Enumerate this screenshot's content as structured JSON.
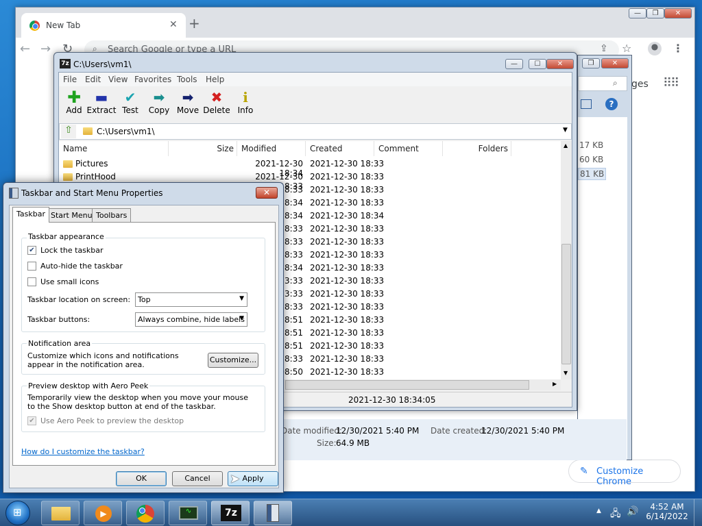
{
  "chrome": {
    "tab_title": "New Tab",
    "omnibox_placeholder": "Search Google or type a URL",
    "partial_label_images": "ges",
    "customize_chrome": "Customize Chrome",
    "file_sizes": [
      "17 KB",
      "60 KB",
      "81 KB"
    ]
  },
  "sevenzip": {
    "title": "C:\\Users\\vm1\\",
    "path": "C:\\Users\\vm1\\",
    "menu": [
      "File",
      "Edit",
      "View",
      "Favorites",
      "Tools",
      "Help"
    ],
    "toolbar": [
      {
        "label": "Add",
        "glyph": "+",
        "color": "#1fa31f"
      },
      {
        "label": "Extract",
        "glyph": "━",
        "color": "#2233aa"
      },
      {
        "label": "Test",
        "glyph": "✔",
        "color": "#1ba4b0"
      },
      {
        "label": "Copy",
        "glyph": "➡",
        "color": "#1a8f8f"
      },
      {
        "label": "Move",
        "glyph": "➡",
        "color": "#14216e"
      },
      {
        "label": "Delete",
        "glyph": "✖",
        "color": "#d42020"
      },
      {
        "label": "Info",
        "glyph": "i",
        "color": "#b8a400"
      }
    ],
    "columns": [
      "Name",
      "Size",
      "Modified",
      "Created",
      "Comment",
      "Folders"
    ],
    "rows": [
      {
        "name": "Pictures",
        "modified": "2021-12-30 18:34",
        "created": "2021-12-30 18:33"
      },
      {
        "name": "PrintHood",
        "modified": "2021-12-30 18:33",
        "created": "2021-12-30 18:33"
      },
      {
        "name": "",
        "modified": "18:33",
        "created": "2021-12-30 18:33"
      },
      {
        "name": "",
        "modified": "18:34",
        "created": "2021-12-30 18:33"
      },
      {
        "name": "",
        "modified": "18:34",
        "created": "2021-12-30 18:34"
      },
      {
        "name": "",
        "modified": "18:33",
        "created": "2021-12-30 18:33"
      },
      {
        "name": "",
        "modified": "18:33",
        "created": "2021-12-30 18:33"
      },
      {
        "name": "",
        "modified": "18:33",
        "created": "2021-12-30 18:33"
      },
      {
        "name": "",
        "modified": "18:34",
        "created": "2021-12-30 18:33"
      },
      {
        "name": "",
        "modified": "13:33",
        "created": "2021-12-30 18:33"
      },
      {
        "name": "",
        "modified": "13:33",
        "created": "2021-12-30 18:33"
      },
      {
        "name": "",
        "modified": "18:33",
        "created": "2021-12-30 18:33"
      },
      {
        "name": "",
        "modified": "18:51",
        "created": "2021-12-30 18:33"
      },
      {
        "name": "",
        "modified": "18:51",
        "created": "2021-12-30 18:33"
      },
      {
        "name": "",
        "modified": "18:51",
        "created": "2021-12-30 18:33"
      },
      {
        "name": "",
        "modified": "18:33",
        "created": "2021-12-30 18:33"
      },
      {
        "name": "",
        "modified": "08:50",
        "created": "2021-12-30 18:33"
      }
    ],
    "status_text": "2021-12-30 18:34:05"
  },
  "details": {
    "modified_label": "Date modified:",
    "modified_value": "12/30/2021 5:40 PM",
    "created_label": "Date created:",
    "created_value": "12/30/2021 5:40 PM",
    "size_label": "Size:",
    "size_value": "64.9 MB"
  },
  "dialog": {
    "title": "Taskbar and Start Menu Properties",
    "tabs": [
      "Taskbar",
      "Start Menu",
      "Toolbars"
    ],
    "appearance": {
      "group": "Taskbar appearance",
      "lock": "Lock the taskbar",
      "autohide": "Auto-hide the taskbar",
      "small_icons": "Use small icons",
      "location_label": "Taskbar location on screen:",
      "location_value": "Top",
      "buttons_label": "Taskbar buttons:",
      "buttons_value": "Always combine, hide labels"
    },
    "notification": {
      "group": "Notification area",
      "text": "Customize which icons and notifications appear in the notification area.",
      "button": "Customize..."
    },
    "aero": {
      "group": "Preview desktop with Aero Peek",
      "text": "Temporarily view the desktop when you move your mouse to the Show desktop button at end of the taskbar.",
      "checkbox": "Use Aero Peek to preview the desktop"
    },
    "help_link": "How do I customize the taskbar?",
    "ok": "OK",
    "cancel": "Cancel",
    "apply": "Apply"
  },
  "taskbar": {
    "time": "4:52 AM",
    "date": "6/14/2022",
    "zip_label": "7z"
  }
}
